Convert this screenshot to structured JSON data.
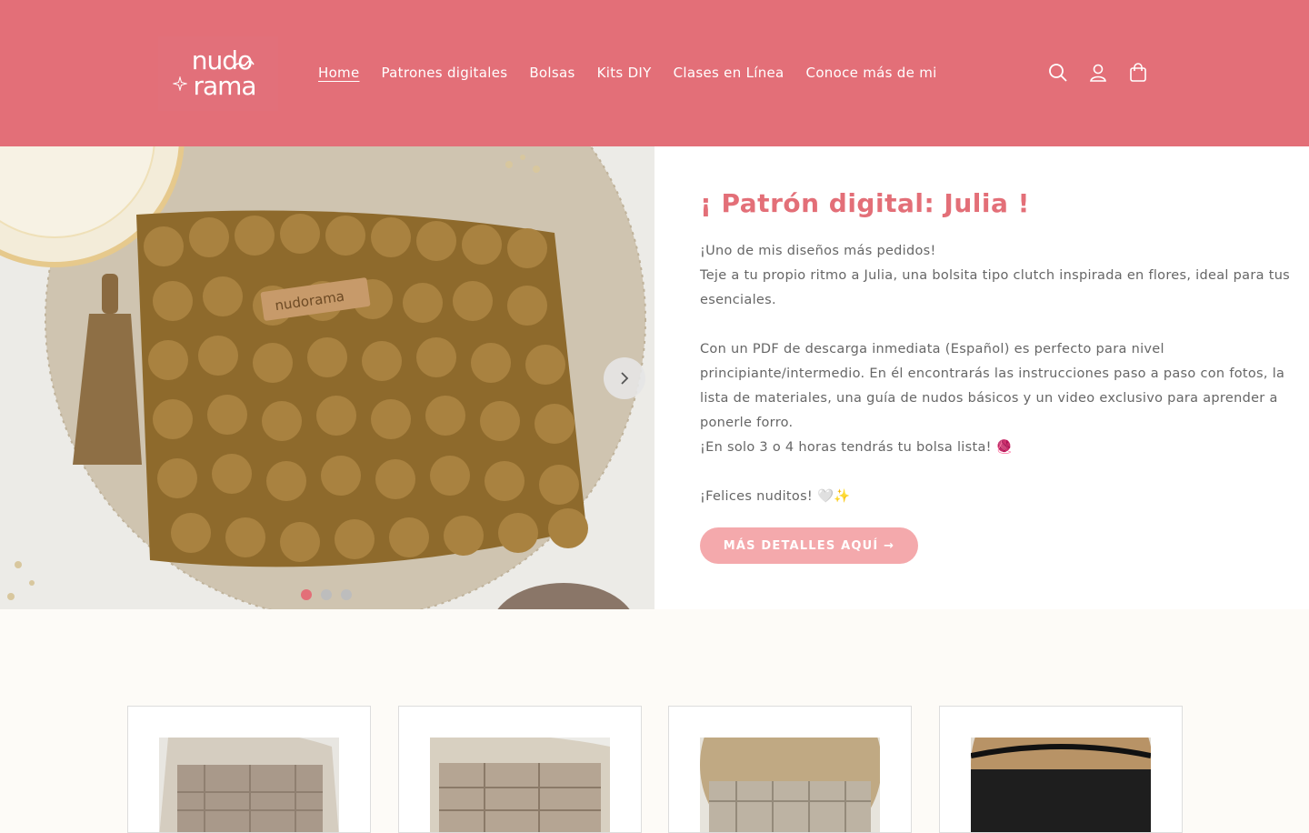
{
  "brand": {
    "line1": "nudo",
    "line2": "rama",
    "color": "#e36f78"
  },
  "nav": [
    {
      "label": "Home",
      "active": true
    },
    {
      "label": "Patrones digitales"
    },
    {
      "label": "Bolsas"
    },
    {
      "label": "Kits DIY"
    },
    {
      "label": "Clases en Línea"
    },
    {
      "label": "Conoce más de mi"
    }
  ],
  "header_icons": [
    "search-icon",
    "account-icon",
    "cart-icon"
  ],
  "hero": {
    "title": "¡ Patrón digital: Julia !",
    "paragraphs": [
      "¡Uno de mis diseños más pedidos!",
      "Teje a tu propio ritmo a Julia, una bolsita tipo clutch inspirada en flores, ideal para tus esenciales.",
      "",
      "Con un PDF de descarga inmediata (Español) es perfecto para nivel principiante/intermedio. En él encontrarás las instrucciones paso a paso con fotos, la lista de materiales, una guía de nudos básicos y un video exclusivo para aprender a ponerle forro.",
      "¡En solo 3 o 4 horas tendrás tu bolsa lista! 🧶",
      "",
      " ¡Felices nuditos! 🤍✨"
    ],
    "cta_label": "MÁS DETALLES AQUÍ →",
    "tag_text": "nudorama",
    "slides_total": 3,
    "slide_active": 1
  }
}
